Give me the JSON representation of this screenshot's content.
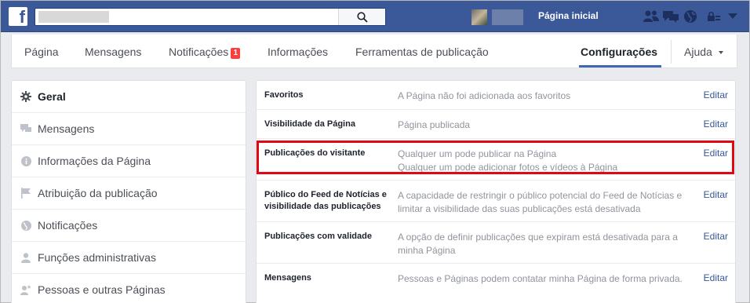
{
  "topbar": {
    "logo": "f",
    "home_label": "Página inicial",
    "icons": [
      "search-icon",
      "friends-icon",
      "messages-icon",
      "globe-icon",
      "lock-icon",
      "dropdown-arrow-icon"
    ]
  },
  "page_nav": {
    "items": [
      "Página",
      "Mensagens",
      "Notificações",
      "Informações",
      "Ferramentas de publicação"
    ],
    "notification_count": "1",
    "active": "Configurações",
    "help": "Ajuda"
  },
  "left_menu": {
    "items": [
      {
        "label": "Geral",
        "icon": "gear-icon"
      },
      {
        "label": "Mensagens",
        "icon": "message-icon"
      },
      {
        "label": "Informações da Página",
        "icon": "info-icon"
      },
      {
        "label": "Atribuição da publicação",
        "icon": "flag-icon"
      },
      {
        "label": "Notificações",
        "icon": "globe-icon"
      },
      {
        "label": "Funções administrativas",
        "icon": "person-icon"
      },
      {
        "label": "Pessoas e outras Páginas",
        "icon": "people-icon"
      }
    ]
  },
  "settings": {
    "rows": [
      {
        "title": "Favoritos",
        "value": "A Página não foi adicionada aos favoritos",
        "value2": "",
        "edit": "Editar"
      },
      {
        "title": "Visibilidade da Página",
        "value": "Página publicada",
        "value2": "",
        "edit": "Editar"
      },
      {
        "title": "Publicações do visitante",
        "value": "Qualquer um pode publicar na Página",
        "value2": "Qualquer um pode adicionar fotos e vídeos à Página",
        "edit": "Editar"
      },
      {
        "title": "Público do Feed de Notícias e visibilidade das publicações",
        "value": "A capacidade de restringir o público potencial do Feed de Notícias e limitar a visibilidade das suas publicações está desativada",
        "value2": "",
        "edit": "Editar"
      },
      {
        "title": "Publicações com validade",
        "value": "A opção de definir publicações que expiram está desativada para a minha Página",
        "value2": "",
        "edit": "Editar"
      },
      {
        "title": "Mensagens",
        "value": "Pessoas e Páginas podem contatar minha Página de forma privada.",
        "value2": "",
        "edit": "Editar"
      }
    ]
  },
  "colors": {
    "topbar": "#3b5998",
    "accent": "#4267b2",
    "highlight": "#e30613",
    "badge": "#fa3e3e",
    "link": "#365899"
  }
}
